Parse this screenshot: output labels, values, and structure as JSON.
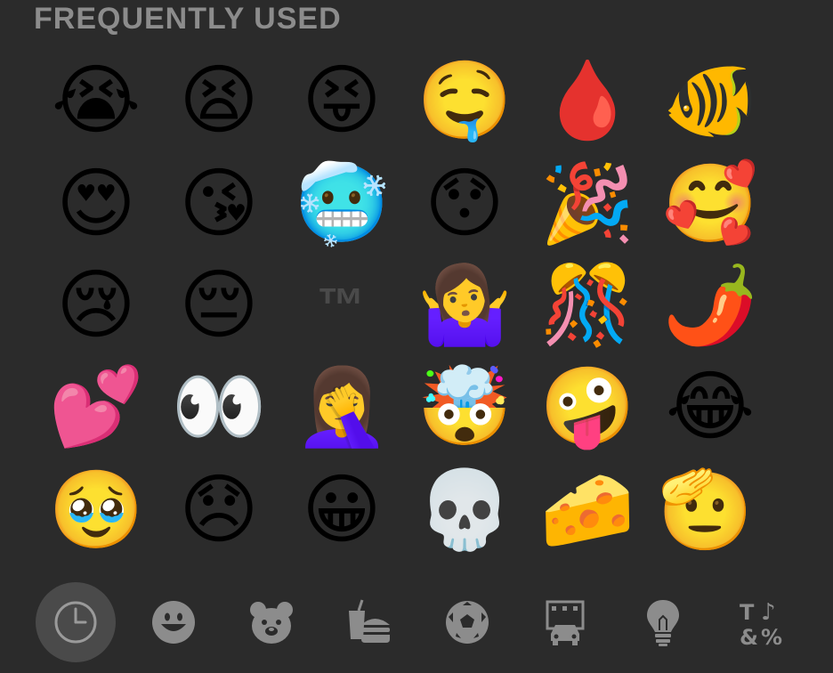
{
  "section": {
    "title": "FREQUENTLY USED"
  },
  "emoji_grid": [
    [
      "😭",
      "😫",
      "😝",
      "🤤",
      "🩸",
      "🐠"
    ],
    [
      "😍",
      "😘",
      "🥶",
      "😯",
      "🎉",
      "🥰"
    ],
    [
      "😢",
      "😔",
      "™",
      "🤷‍♀️",
      "🎊",
      "🌶️"
    ],
    [
      "💕",
      "👀",
      "🤦‍♀️",
      "🤯",
      "🤪",
      "😂"
    ],
    [
      "🥹",
      "😞",
      "😀",
      "💀",
      "🧀",
      "🫡"
    ]
  ],
  "category_tabs": [
    {
      "name": "frequently-used",
      "icon": "clock-icon",
      "active": true
    },
    {
      "name": "smileys-people",
      "icon": "smiley-icon",
      "active": false
    },
    {
      "name": "animals-nature",
      "icon": "bear-icon",
      "active": false
    },
    {
      "name": "food-drink",
      "icon": "burger-drink-icon",
      "active": false
    },
    {
      "name": "activity",
      "icon": "soccer-ball-icon",
      "active": false
    },
    {
      "name": "travel-places",
      "icon": "building-car-icon",
      "active": false
    },
    {
      "name": "objects",
      "icon": "lightbulb-icon",
      "active": false
    },
    {
      "name": "symbols",
      "icon": "symbols-icon",
      "active": false
    }
  ],
  "colors": {
    "background": "#2b2b2b",
    "icon": "#8c8c8c",
    "active_tab": "#4a4a4a"
  }
}
